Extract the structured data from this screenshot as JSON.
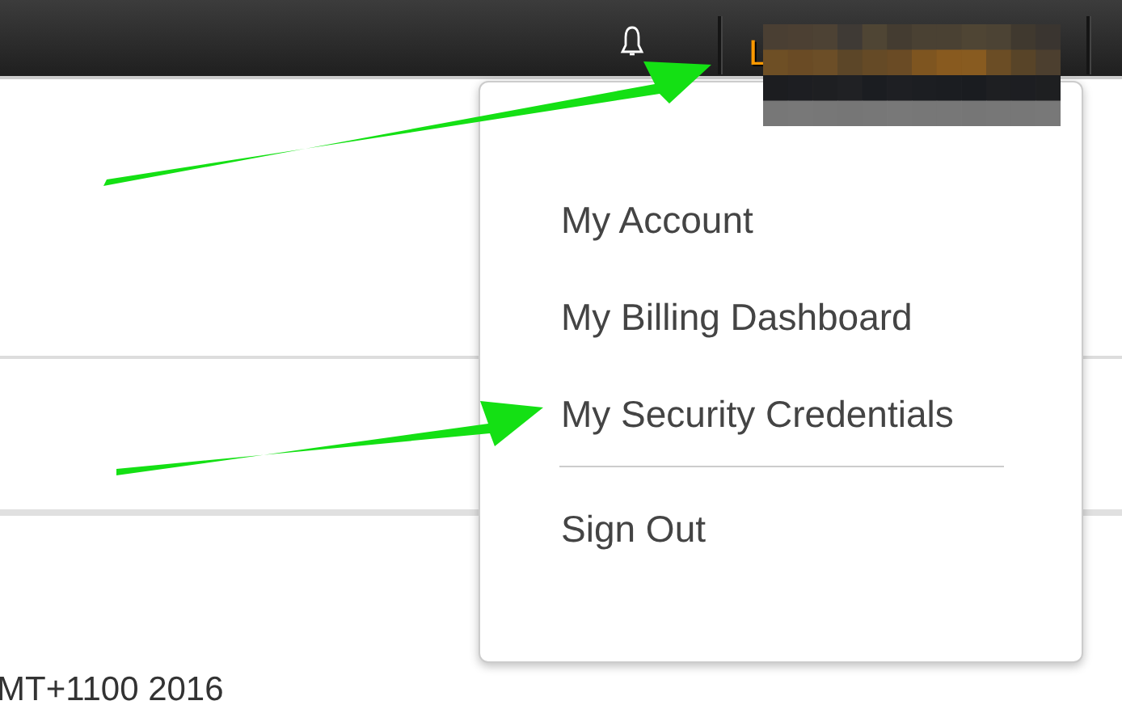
{
  "top_bar": {
    "user_menu": {
      "label": "L",
      "expanded": true
    }
  },
  "dropdown": {
    "items": [
      {
        "label": "My Account",
        "kind": "item"
      },
      {
        "label": "My Billing Dashboard",
        "kind": "item"
      },
      {
        "label": "My Security Credentials",
        "kind": "item"
      },
      {
        "kind": "divider"
      },
      {
        "label": "Sign Out",
        "kind": "item"
      }
    ]
  },
  "content": {
    "timestamp": "MT+1100 2016"
  }
}
